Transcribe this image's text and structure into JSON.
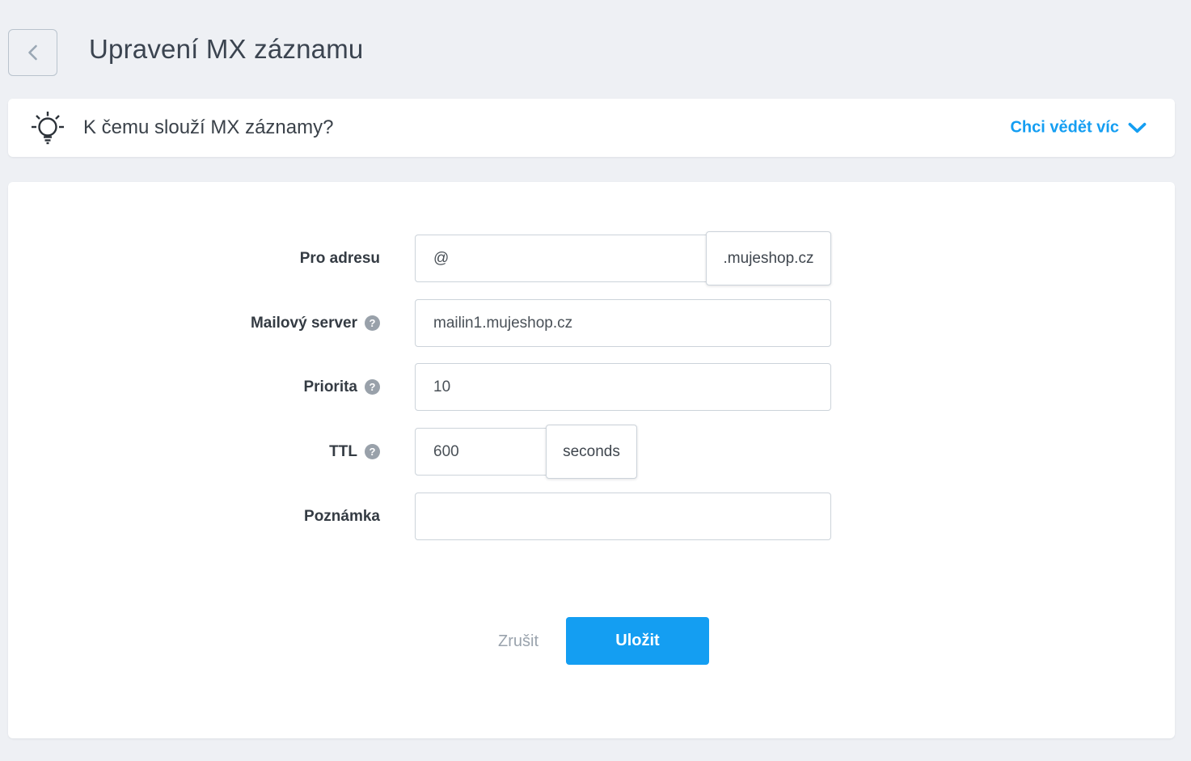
{
  "header": {
    "title": "Upravení MX záznamu"
  },
  "info_bar": {
    "question": "K čemu slouží MX záznamy?",
    "more_link": "Chci vědět víc"
  },
  "form": {
    "help_glyph": "?",
    "rows": [
      {
        "label": "Pro adresu",
        "value": "@",
        "suffix": ".mujeshop.cz",
        "has_help": false
      },
      {
        "label": "Mailový server",
        "value": "mailin1.mujeshop.cz",
        "has_help": true
      },
      {
        "label": "Priorita",
        "value": "10",
        "has_help": true
      },
      {
        "label": "TTL",
        "value": "600",
        "suffix": "seconds",
        "has_help": true
      },
      {
        "label": "Poznámka",
        "value": "",
        "has_help": false
      }
    ]
  },
  "actions": {
    "cancel": "Zrušit",
    "save": "Uložit"
  },
  "colors": {
    "accent_blue": "#149ef2",
    "page_background": "#eef0f4",
    "card_background": "#ffffff",
    "help_icon_gray": "#99a1aa",
    "input_border": "#ccd3da",
    "title_text": "#3b4450"
  }
}
